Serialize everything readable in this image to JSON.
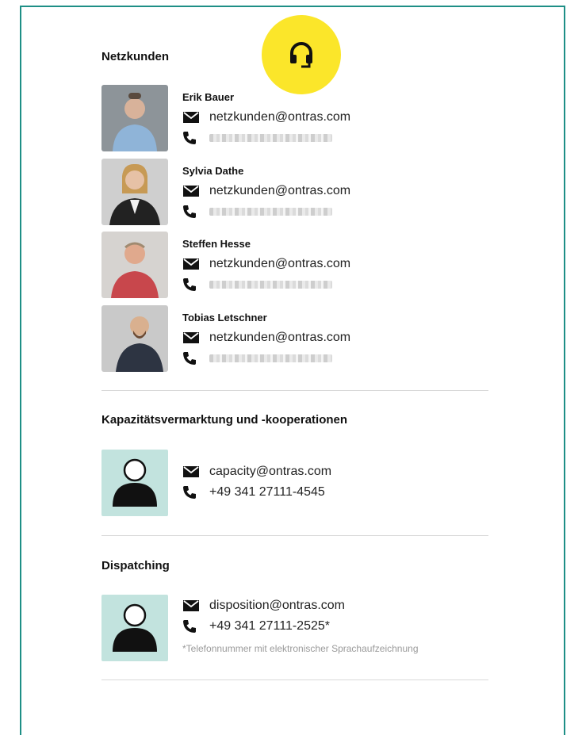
{
  "sections": {
    "netzkunden": {
      "title": "Netzkunden",
      "people": [
        {
          "name": "Erik Bauer",
          "email": "netzkunden@ontras.com"
        },
        {
          "name": "Sylvia Dathe",
          "email": "netzkunden@ontras.com"
        },
        {
          "name": "Steffen Hesse",
          "email": "netzkunden@ontras.com"
        },
        {
          "name": "Tobias Letschner",
          "email": "netzkunden@ontras.com"
        }
      ]
    },
    "capacity": {
      "title": "Kapazitätsvermarktung und -kooperationen",
      "email": "capacity@ontras.com",
      "phone": "+49 341 27111-4545"
    },
    "dispatching": {
      "title": "Dispatching",
      "email": "disposition@ontras.com",
      "phone": "+49 341 27111-2525*",
      "note": "*Telefonnummer mit elektronischer Sprachaufzeichnung"
    }
  },
  "icons": {
    "badge": "headset-icon",
    "mail": "mail-icon",
    "phone": "phone-icon",
    "avatar": "person-silhouette-icon"
  },
  "colors": {
    "frame": "#1e8f86",
    "badge": "#fbe62a",
    "avatar_bg": "#c2e3de"
  }
}
